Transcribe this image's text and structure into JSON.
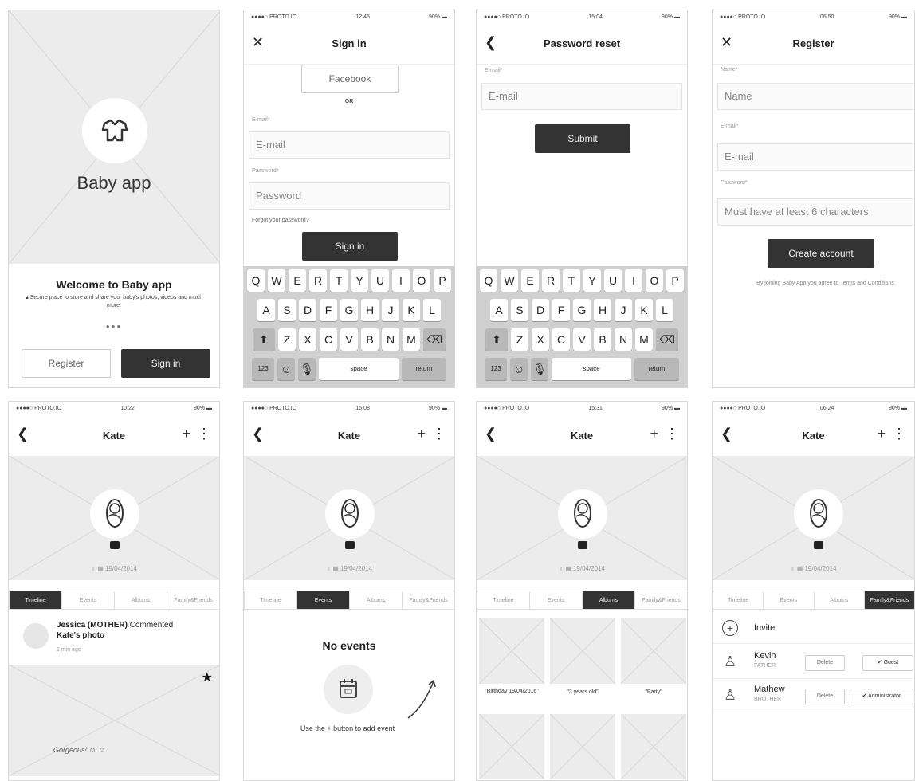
{
  "status": {
    "carrier": "●●●●○ PROTO.IO",
    "battery": "90%",
    "times": [
      "12:45",
      "15:04",
      "06:50",
      "10:22",
      "15:08",
      "15:31",
      "06:24"
    ]
  },
  "welcome": {
    "app_name": "Baby app",
    "heading": "Welcome to Baby app",
    "description": "Secure place to store and share your baby's photos, videos and much more.",
    "register_label": "Register",
    "signin_label": "Sign in"
  },
  "signin": {
    "title": "Sign in",
    "facebook_label": "Facebook",
    "or_label": "OR",
    "email_label": "E-mail*",
    "email_placeholder": "E-mail",
    "password_label": "Password*",
    "password_placeholder": "Password",
    "forgot_label": "Forgot your password?",
    "submit_label": "Sign in"
  },
  "reset": {
    "title": "Password reset",
    "email_label": "E-mail*",
    "email_placeholder": "E-mail",
    "submit_label": "Submit"
  },
  "register": {
    "title": "Register",
    "name_label": "Name*",
    "name_placeholder": "Name",
    "email_label": "E-mail*",
    "email_placeholder": "E-mail",
    "password_label": "Password*",
    "password_placeholder": "Must have at least 6 characters",
    "submit_label": "Create account",
    "terms_text": "By joining Baby App you agree to Terms and Conditions"
  },
  "keyboard": {
    "row1": [
      "Q",
      "W",
      "E",
      "R",
      "T",
      "Y",
      "U",
      "I",
      "O",
      "P"
    ],
    "row2": [
      "A",
      "S",
      "D",
      "F",
      "G",
      "H",
      "J",
      "K",
      "L"
    ],
    "row3": [
      "Z",
      "X",
      "C",
      "V",
      "B",
      "N",
      "M"
    ],
    "num_label": "123",
    "space_label": "space",
    "return_label": "return"
  },
  "profile": {
    "name": "Kate",
    "birth_date": "19/04/2014",
    "tabs": [
      "Timeline",
      "Events",
      "Albums",
      "Family&Friends"
    ]
  },
  "timeline": {
    "commenter": "Jessica (MOTHER)",
    "action": "Commented",
    "target": "Kate's photo",
    "time": "1 min ago",
    "comment": "Gorgeous!"
  },
  "events": {
    "empty_title": "No events",
    "hint": "Use the + button to add event"
  },
  "albums": {
    "items": [
      "\"Birthday 19/04/2016\"",
      "\"3 years old\"",
      "\"Party\""
    ]
  },
  "family": {
    "invite_label": "Invite",
    "members": [
      {
        "name": "Kevin",
        "role": "FATHER",
        "delete_label": "Delete",
        "status": "Guest"
      },
      {
        "name": "Mathew",
        "role": "BROTHER",
        "delete_label": "Delete",
        "status": "Administrator"
      }
    ]
  },
  "colors": {
    "dark_button": "#333333",
    "placeholder_bg": "#ececec",
    "keyboard_bg": "#d0d0d0"
  }
}
